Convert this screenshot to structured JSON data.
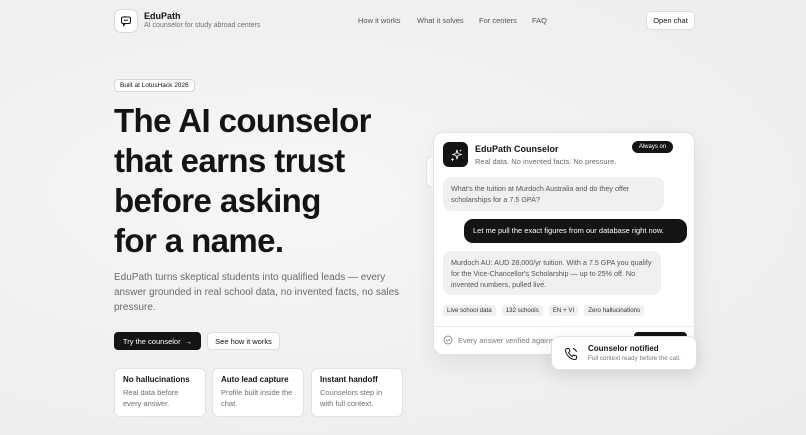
{
  "header": {
    "brand_name": "EduPath",
    "brand_tagline": "AI counselor for study abroad centers",
    "nav": [
      "How it works",
      "What it solves",
      "For centers",
      "FAQ"
    ],
    "open_chat_label": "Open chat"
  },
  "hero": {
    "badge": "Built at LotusHack 2026",
    "headline_lines": [
      "The AI counselor",
      "that earns trust",
      "before asking",
      "for a name."
    ],
    "subtext": "EduPath turns skeptical students into qualified leads — every answer grounded in real school data, no invented facts, no sales pressure.",
    "primary_cta": "Try the counselor",
    "primary_cta_arrow": "→",
    "secondary_cta": "See how it works",
    "features": [
      {
        "title": "No hallucinations",
        "desc": "Real data before every answer."
      },
      {
        "title": "Auto lead capture",
        "desc": "Profile built inside the chat."
      },
      {
        "title": "Instant handoff",
        "desc": "Counselors step in with full context."
      }
    ]
  },
  "chat": {
    "title": "EduPath Counselor",
    "subtitle": "Real data. No invented facts. No pressure.",
    "status": "Always on",
    "messages": [
      "What's the tuition at Murdoch Australia and do they offer scholarships for a 7.5 GPA?",
      "Let me pull the exact figures from our database right now.",
      "Murdoch AU: AUD 28,000/yr tuition. With a 7.5 GPA you qualify for the Vice-Chancellor's Scholarship — up to 25% off. No invented numbers, pulled live."
    ],
    "chips": [
      "Live school data",
      "132 schools",
      "EN + VI",
      "Zero hallucinations"
    ],
    "footer_text": "Every answer verified against"
  },
  "notification": {
    "title": "Counselor notified",
    "subtitle": "Full context ready before the call."
  },
  "icons": {
    "logo": "chat-bubble-icon",
    "chat_avatar": "sparkles-icon",
    "verify": "check-circle-icon",
    "notify": "phone-icon"
  },
  "colors": {
    "primary": "#141414",
    "background": "#f1f1f1",
    "muted_text": "#6a6a6a"
  }
}
